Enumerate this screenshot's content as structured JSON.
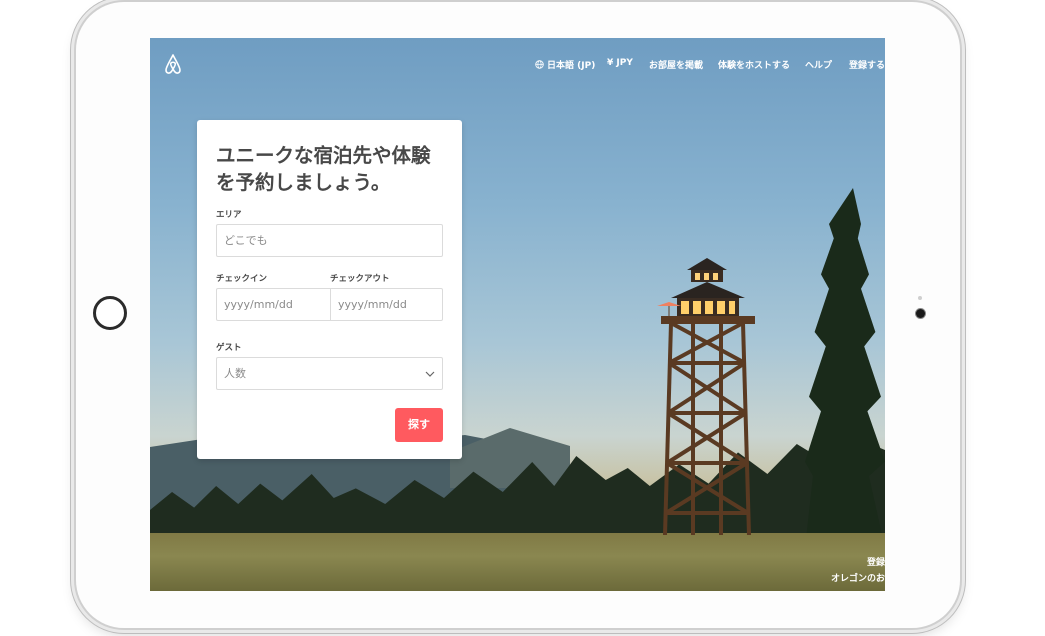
{
  "nav": {
    "language": "日本語 (JP)",
    "currency": "¥ JPY",
    "list_room": "お部屋を掲載",
    "host_experience": "体験をホストする",
    "help": "ヘルプ",
    "signup": "登録する"
  },
  "search_form": {
    "headline": "ユニークな宿泊先や体験を予約しましょう。",
    "area_label": "エリア",
    "area_placeholder": "どこでも",
    "checkin_label": "チェックイン",
    "checkin_placeholder": "yyyy/mm/dd",
    "checkout_label": "チェックアウト",
    "checkout_placeholder": "yyyy/mm/dd",
    "guests_label": "ゲスト",
    "guests_placeholder": "人数",
    "search_button": "探す"
  },
  "photo_caption": {
    "line1": "登録",
    "line2": "オレゴンのお"
  },
  "colors": {
    "accent": "#ff5a5f",
    "text": "#484848"
  }
}
